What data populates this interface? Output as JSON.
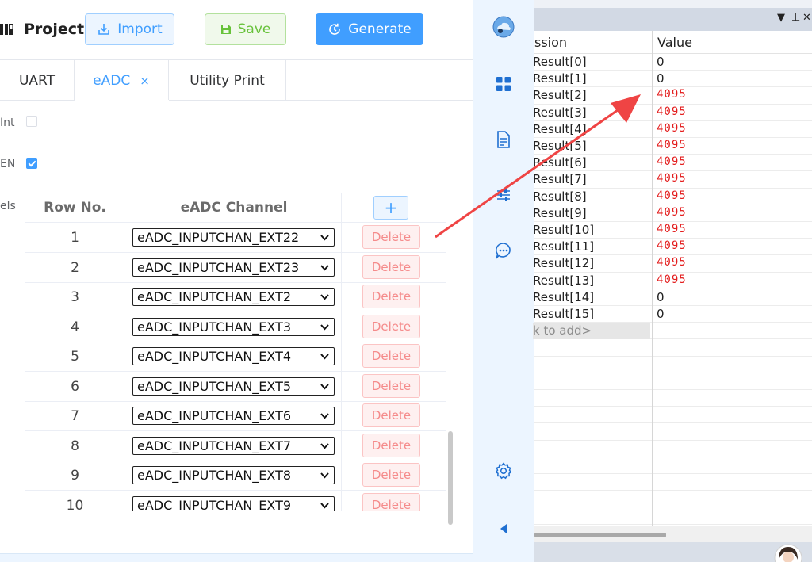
{
  "header": {
    "title": "Project M",
    "import_label": "Import",
    "save_label": "Save",
    "generate_label": "Generate"
  },
  "tabs": [
    {
      "label": "UART"
    },
    {
      "label": "eADC",
      "close": "×"
    },
    {
      "label": "Utility Print"
    }
  ],
  "settings": {
    "int_label": "Int",
    "int_checked": false,
    "en_label": "EN",
    "en_checked": true,
    "channels_label": "els"
  },
  "table": {
    "col_row": "Row No.",
    "col_channel": "eADC Channel",
    "add_label": "+",
    "delete_label": "Delete",
    "rows": [
      {
        "no": "1",
        "channel": "eADC_INPUTCHAN_EXT22"
      },
      {
        "no": "2",
        "channel": "eADC_INPUTCHAN_EXT23"
      },
      {
        "no": "3",
        "channel": "eADC_INPUTCHAN_EXT2"
      },
      {
        "no": "4",
        "channel": "eADC_INPUTCHAN_EXT3"
      },
      {
        "no": "5",
        "channel": "eADC_INPUTCHAN_EXT4"
      },
      {
        "no": "6",
        "channel": "eADC_INPUTCHAN_EXT5"
      },
      {
        "no": "7",
        "channel": "eADC_INPUTCHAN_EXT6"
      },
      {
        "no": "8",
        "channel": "eADC_INPUTCHAN_EXT7"
      },
      {
        "no": "9",
        "channel": "eADC_INPUTCHAN_EXT8"
      },
      {
        "no": "10",
        "channel": "eADC_INPUTCHAN_EXT9"
      }
    ]
  },
  "rail": {
    "icons": [
      "cloud-logo-icon",
      "grid-icon",
      "document-icon",
      "sliders-icon",
      "chat-icon",
      "gear-icon",
      "collapse-arrow-icon"
    ]
  },
  "watch": {
    "toolbar": {
      "dropdown": "▼",
      "pin": "⊥",
      "close": "✕"
    },
    "col_expression": "ssion",
    "col_value": "Value",
    "rows": [
      {
        "name": "Result[0]",
        "value": "0",
        "changed": false
      },
      {
        "name": "Result[1]",
        "value": "0",
        "changed": false
      },
      {
        "name": "Result[2]",
        "value": "4095",
        "changed": true
      },
      {
        "name": "Result[3]",
        "value": "4095",
        "changed": true
      },
      {
        "name": "Result[4]",
        "value": "4095",
        "changed": true
      },
      {
        "name": "Result[5]",
        "value": "4095",
        "changed": true
      },
      {
        "name": "Result[6]",
        "value": "4095",
        "changed": true
      },
      {
        "name": "Result[7]",
        "value": "4095",
        "changed": true
      },
      {
        "name": "Result[8]",
        "value": "4095",
        "changed": true
      },
      {
        "name": "Result[9]",
        "value": "4095",
        "changed": true
      },
      {
        "name": "Result[10]",
        "value": "4095",
        "changed": true
      },
      {
        "name": "Result[11]",
        "value": "4095",
        "changed": true
      },
      {
        "name": "Result[12]",
        "value": "4095",
        "changed": true
      },
      {
        "name": "Result[13]",
        "value": "4095",
        "changed": true
      },
      {
        "name": "Result[14]",
        "value": "0",
        "changed": false
      },
      {
        "name": "Result[15]",
        "value": "0",
        "changed": false
      }
    ],
    "add_row": "k to add>"
  },
  "colors": {
    "accent": "#409eff",
    "success": "#67c23a",
    "danger": "#f56c6c",
    "changed_value": "#e31b1b",
    "annotation_arrow": "#ef4444"
  }
}
